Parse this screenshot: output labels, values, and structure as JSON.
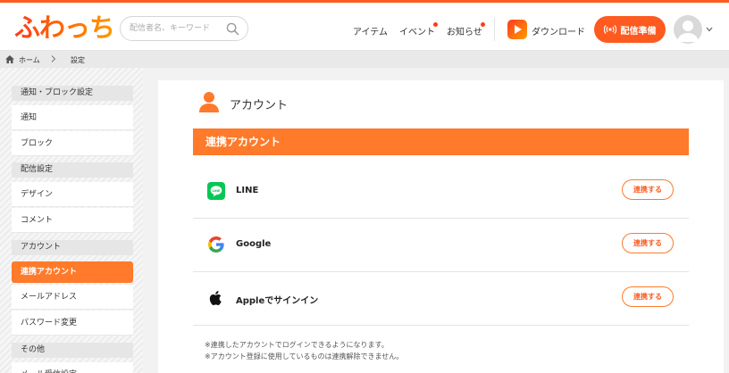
{
  "header": {
    "logo_text": "ふわっち",
    "search_placeholder": "配信者名、キーワード",
    "nav": [
      {
        "label": "アイテム",
        "has_dot": false
      },
      {
        "label": "イベント",
        "has_dot": true
      },
      {
        "label": "お知らせ",
        "has_dot": true
      }
    ],
    "download_label": "ダウンロード",
    "live_button_label": "配信準備",
    "accent_color": "#ff5a1f"
  },
  "breadcrumb": {
    "home": "ホーム",
    "current": "設定"
  },
  "sidebar": {
    "groups": [
      {
        "header": "通知・ブロック設定",
        "items": [
          "通知",
          "ブロック"
        ]
      },
      {
        "header": "配信設定",
        "items": [
          "デザイン",
          "コメント"
        ]
      },
      {
        "header": "アカウント",
        "items": [
          "連携アカウント",
          "メールアドレス",
          "パスワード変更"
        ]
      },
      {
        "header": "その他",
        "items": [
          "メール受信設定"
        ]
      }
    ],
    "active_item": "連携アカウント"
  },
  "main": {
    "account_title": "アカウント",
    "section_title": "連携アカウント",
    "providers": [
      {
        "name": "LINE",
        "icon": "line-icon",
        "button": "連携する"
      },
      {
        "name": "Google",
        "icon": "google-icon",
        "button": "連携する"
      },
      {
        "name": "Appleでサインイン",
        "icon": "apple-icon",
        "button": "連携する"
      }
    ],
    "notes": [
      "※連携したアカウントでログインできるようになります。",
      "※アカウント登録に使用しているものは連携解除できません。"
    ]
  }
}
